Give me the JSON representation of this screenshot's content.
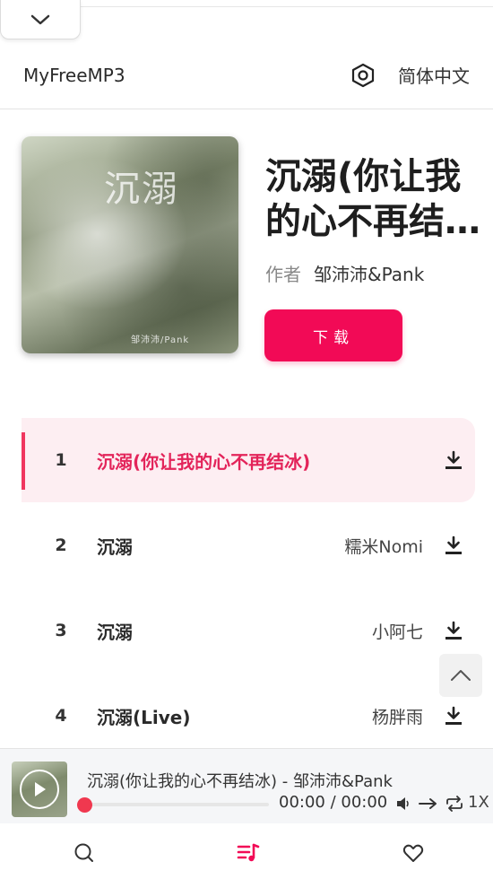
{
  "header": {
    "brand": "MyFreeMP3",
    "language": "简体中文"
  },
  "album": {
    "title": "沉溺(你让我的心不再结冰)",
    "author_label": "作者",
    "author": "邹沛沛&Pank",
    "download_label": "下载",
    "cover_title": "沉溺",
    "cover_credit": "邹沛沛/Pank"
  },
  "tracks": [
    {
      "number": "1",
      "title": "沉溺(你让我的心不再结冰)",
      "artist": "",
      "active": true
    },
    {
      "number": "2",
      "title": "沉溺",
      "artist": "糯米Nomi",
      "active": false
    },
    {
      "number": "3",
      "title": "沉溺",
      "artist": "小阿七",
      "active": false
    },
    {
      "number": "4",
      "title": "沉溺(Live)",
      "artist": "杨胖雨",
      "active": false
    }
  ],
  "player": {
    "now_playing": "沉溺(你让我的心不再结冰) - 邹沛沛&Pank",
    "time": "00:00 / 00:00",
    "speed": "1X",
    "progress": 0
  },
  "colors": {
    "accent": "#f20a56",
    "active_text": "#e3245a",
    "active_bg": "#fdeef2",
    "progress_knob": "#f0384f"
  },
  "icons": {
    "collapse": "chevron-down-icon",
    "theme": "hexagon-settings-icon",
    "download": "download-icon",
    "scroll_top": "chevron-up-icon",
    "play": "play-icon",
    "volume": "volume-icon",
    "order": "arrow-right-icon",
    "repeat": "repeat-icon",
    "search": "search-icon",
    "playlist": "playlist-icon",
    "favorite": "heart-icon"
  }
}
